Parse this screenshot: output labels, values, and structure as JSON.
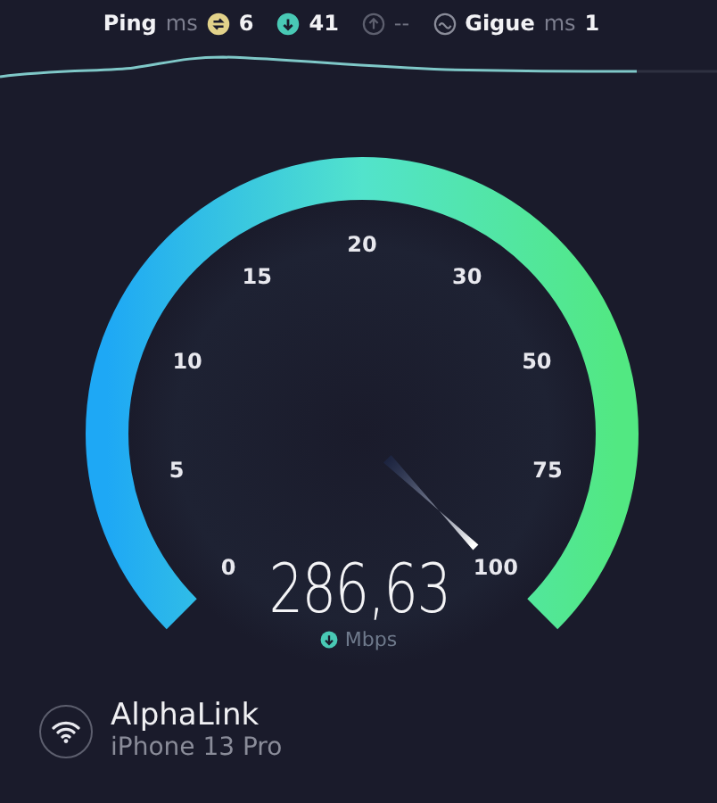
{
  "header": {
    "ping_label": "Ping",
    "ping_unit": "ms",
    "readings": [
      {
        "kind": "idle",
        "value": "6"
      },
      {
        "kind": "download",
        "value": "41"
      },
      {
        "kind": "upload",
        "value": "--"
      }
    ],
    "jitter": {
      "label": "Gigue",
      "unit": "ms",
      "value": "1"
    }
  },
  "gauge": {
    "scale": [
      "0",
      "5",
      "10",
      "15",
      "20",
      "30",
      "50",
      "75",
      "100"
    ],
    "value": "286,63",
    "unit": "Mbps"
  },
  "connection": {
    "name": "AlphaLink",
    "device": "iPhone 13 Pro"
  }
}
